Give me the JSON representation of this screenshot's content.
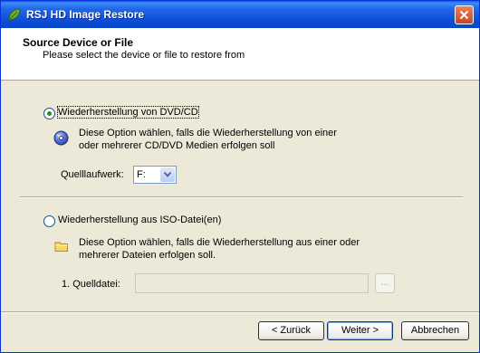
{
  "window": {
    "title": "RSJ HD Image Restore",
    "close_icon": "close-icon",
    "app_icon": "app-leaf-icon"
  },
  "header": {
    "title": "Source Device or File",
    "subtitle": "Please select the device or file to restore from"
  },
  "option_dvd": {
    "label": "Wiederherstellung von DVD/CD",
    "selected": true,
    "icon": "dvd-disc-icon",
    "description_line1": "Diese Option wählen, falls die Wiederherstellung von einer",
    "description_line2": "oder mehrerer CD/DVD Medien erfolgen soll",
    "drive_label": "Quelllaufwerk:",
    "drive_value": "F:"
  },
  "option_iso": {
    "label": "Wiederherstellung aus ISO-Datei(en)",
    "selected": false,
    "icon": "folder-icon",
    "description_line1": "Diese Option wählen, falls die Wiederherstellung aus einer oder",
    "description_line2": "mehrerer Dateien erfolgen soll.",
    "file_label": "1. Quelldatei:",
    "file_value": "",
    "browse_label": "..."
  },
  "buttons": {
    "back": "< Zurück",
    "next": "Weiter >",
    "cancel": "Abbrechen"
  },
  "colors": {
    "titlebar": "#0a4fd8",
    "dialog_bg": "#ece9d8",
    "radio_dot": "#2a8a2a"
  }
}
